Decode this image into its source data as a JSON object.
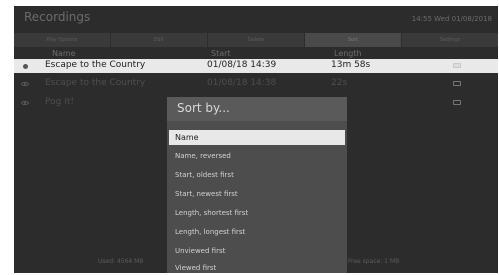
{
  "app": {
    "title": "Recordings",
    "clock": "14:55 Wed 01/08/2018"
  },
  "menu": [
    {
      "label": "Play Options",
      "active": false
    },
    {
      "label": "Edit",
      "active": false
    },
    {
      "label": "Delete",
      "active": false
    },
    {
      "label": "Sort",
      "active": true
    },
    {
      "label": "Settings",
      "active": false
    }
  ],
  "columns": {
    "name": "Name",
    "start": "Start",
    "length": "Length"
  },
  "recordings": [
    {
      "icon": "dot-icon",
      "name": "Escape to the Country",
      "start": "01/08/18 14:39",
      "length": "13m 58s",
      "device_icon": "tv-icon"
    },
    {
      "icon": "eye-icon",
      "name": "Escape to the Country",
      "start": "01/08/18 14:38",
      "length": "22s",
      "device_icon": "tv-icon"
    },
    {
      "icon": "eye-icon",
      "name": "Pog It!",
      "start": "",
      "length": "",
      "device_icon": "tv-icon"
    }
  ],
  "footer": {
    "used": "Used: 4564 MB",
    "free": "Free space: 1 MB"
  },
  "sort_dialog": {
    "title": "Sort by...",
    "options": [
      "Name",
      "Name, reversed",
      "Start, oldest first",
      "Start, newest first",
      "Length, shortest first",
      "Length, longest first",
      "Unviewed first",
      "Viewed first"
    ],
    "selected": "Name"
  },
  "colors": {
    "background": "#2c2c2c",
    "selection": "#e9e9e9",
    "dialog": "#4d4d4d"
  }
}
